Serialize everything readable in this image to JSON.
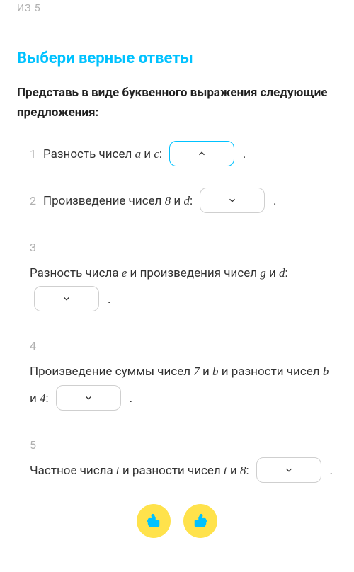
{
  "progress": "ИЗ 5",
  "title": "Выбери верные ответы",
  "subtitle": "Представь в виде буквенного выражения следующие предложения:",
  "items": [
    {
      "num": "1",
      "pre": "Разность чисел ",
      "var1": "a",
      "mid1": " и ",
      "var2": "c",
      "post1": ":"
    },
    {
      "num": "2",
      "pre": "Произведение чисел ",
      "var1": "8",
      "mid1": " и ",
      "var2": "d",
      "post1": ":"
    },
    {
      "num": "3",
      "pre": "Разность числа ",
      "var1": "e",
      "mid1": " и произведения чисел ",
      "var2": "g",
      "mid2": " и ",
      "var3": "d",
      "post1": ":"
    },
    {
      "num": "4",
      "pre": "Произведение суммы чисел ",
      "var1": "7",
      "mid1": " и ",
      "var2": "b",
      "mid2": " и разности чисел ",
      "var3": "b",
      "mid3": " и ",
      "var4": "4",
      "post1": ":"
    },
    {
      "num": "5",
      "pre": "Частное числа ",
      "var1": "t",
      "mid1": " и разности чисел ",
      "var2": "t",
      "mid2": " и ",
      "var3": "8",
      "post1": ":"
    }
  ],
  "period": "."
}
